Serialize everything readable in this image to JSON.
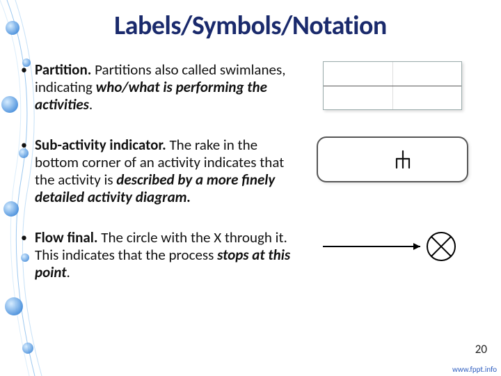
{
  "slide": {
    "title": "Labels/Symbols/Notation",
    "page_number": "20",
    "footer": "www.fppt.info"
  },
  "bullets": [
    {
      "term": "Partition.",
      "rest_plain": "  Partitions also called swimlanes, indicating ",
      "em": "who/what is performing the activities",
      "tail": "."
    },
    {
      "term": "Sub-activity indicator.",
      "rest_plain": "  The rake in the bottom corner of an activity indicates that the activity is ",
      "em": "described by a more finely detailed activity diagram.",
      "tail": ""
    },
    {
      "term": "Flow final.",
      "rest_plain": "  The circle with the X through it.  This indicates that the process ",
      "em": "stops at this point",
      "tail": "."
    }
  ]
}
